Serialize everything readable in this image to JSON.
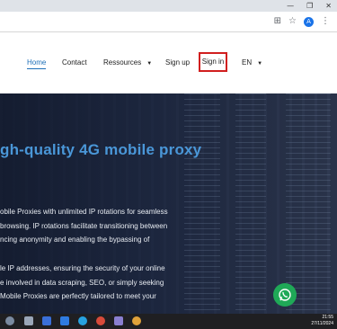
{
  "window": {
    "minimize": "—",
    "maximize": "❐",
    "close": "✕"
  },
  "toolbar": {
    "translate": "⊞",
    "star": "☆",
    "profile": "A",
    "menu": "⋮"
  },
  "nav": {
    "home": "Home",
    "contact": "Contact",
    "resources": "Ressources",
    "signup": "Sign up",
    "signin": "Sign in",
    "language": "EN",
    "caret": "▼"
  },
  "hero": {
    "title": "gh-quality 4G mobile proxy",
    "paragraph1": [
      "obile Proxies with unlimited IP rotations for seamless",
      "browsing. IP rotations facilitate transitioning between",
      "ncing anonymity and enabling the bypassing of"
    ],
    "paragraph2": [
      "le IP addresses, ensuring the security of your online",
      "e involved in data scraping, SEO, or simply seeking",
      "Mobile Proxies are perfectly tailored to meet your"
    ]
  },
  "taskbar": {
    "time": "21:55",
    "date": "27/11/2024"
  },
  "colors": {
    "accent": "#4a97d8",
    "highlight": "#d11f1f",
    "whatsapp": "#1fa957"
  }
}
